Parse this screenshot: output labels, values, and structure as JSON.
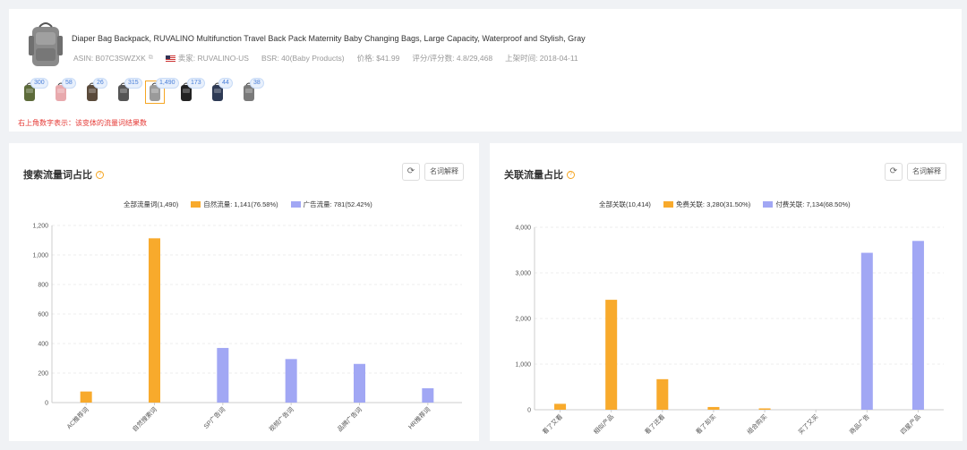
{
  "product": {
    "title": "Diaper Bag Backpack, RUVALINO Multifunction Travel Back Pack Maternity Baby Changing Bags, Large Capacity, Waterproof and Stylish, Gray",
    "asin": "ASIN: B07C3SWZXK",
    "seller": "卖家: RUVALINO-US",
    "bsr": "BSR: 40(Baby Products)",
    "price": "价格: $41.99",
    "rating": "评分/评分数: 4.8/29,468",
    "launch": "上架时间: 2018-04-11"
  },
  "variants": [
    {
      "count": "300",
      "color": "#5d6b3a"
    },
    {
      "count": "58",
      "color": "#e8a9ad"
    },
    {
      "count": "26",
      "color": "#5a4a3a"
    },
    {
      "count": "315",
      "color": "#555555"
    },
    {
      "count": "1,490",
      "color": "#9a9a9a",
      "selected": true
    },
    {
      "count": "173",
      "color": "#222222"
    },
    {
      "count": "44",
      "color": "#2e3a55"
    },
    {
      "count": "38",
      "color": "#7a7a7a"
    }
  ],
  "variant_note": "右上角数字表示：该变体的流量词结果数",
  "left_panel": {
    "title": "搜索流量词占比",
    "explain_label": "名词解释",
    "legend": {
      "total": "全部流量词(1,490)",
      "organic": "自然流量: 1,141(76.58%)",
      "ads": "广告流量: 781(52.42%)"
    }
  },
  "right_panel": {
    "title": "关联流量占比",
    "explain_label": "名词解释",
    "legend": {
      "total": "全部关联(10,414)",
      "free": "免费关联: 3,280(31.50%)",
      "paid": "付费关联: 7,134(68.50%)"
    }
  },
  "colors": {
    "orange": "#f8aa2c",
    "blue": "#a1a7f4",
    "accent": "#f5a623"
  },
  "chart_data": [
    {
      "type": "bar",
      "categories": [
        "AC推荐词",
        "自然搜索词",
        "SP广告词",
        "视频广告词",
        "品牌广告词",
        "HR推荐词"
      ],
      "series": [
        {
          "name": "自然流量",
          "values": [
            75,
            1113,
            0,
            0,
            0,
            0
          ],
          "color": "#f8aa2c"
        },
        {
          "name": "广告流量",
          "values": [
            0,
            0,
            370,
            295,
            262,
            97
          ],
          "color": "#a1a7f4"
        }
      ],
      "ylim": [
        0,
        1200
      ],
      "yticks": [
        "0",
        "200",
        "400",
        "600",
        "800",
        "1,000",
        "1,200"
      ],
      "legend": "top-center"
    },
    {
      "type": "bar",
      "categories": [
        "看了又看",
        "相似产品",
        "看了还看",
        "看了却买",
        "组合购买",
        "买了又买",
        "商品广告",
        "四星产品"
      ],
      "series": [
        {
          "name": "免费关联",
          "values": [
            130,
            2410,
            670,
            60,
            30,
            0,
            0,
            0
          ],
          "color": "#f8aa2c"
        },
        {
          "name": "付费关联",
          "values": [
            0,
            0,
            0,
            0,
            0,
            0,
            3440,
            3700
          ],
          "color": "#a1a7f4"
        }
      ],
      "ylim": [
        0,
        4000
      ],
      "yticks": [
        "0",
        "1,000",
        "2,000",
        "3,000",
        "4,000"
      ],
      "legend": "top-center"
    }
  ]
}
